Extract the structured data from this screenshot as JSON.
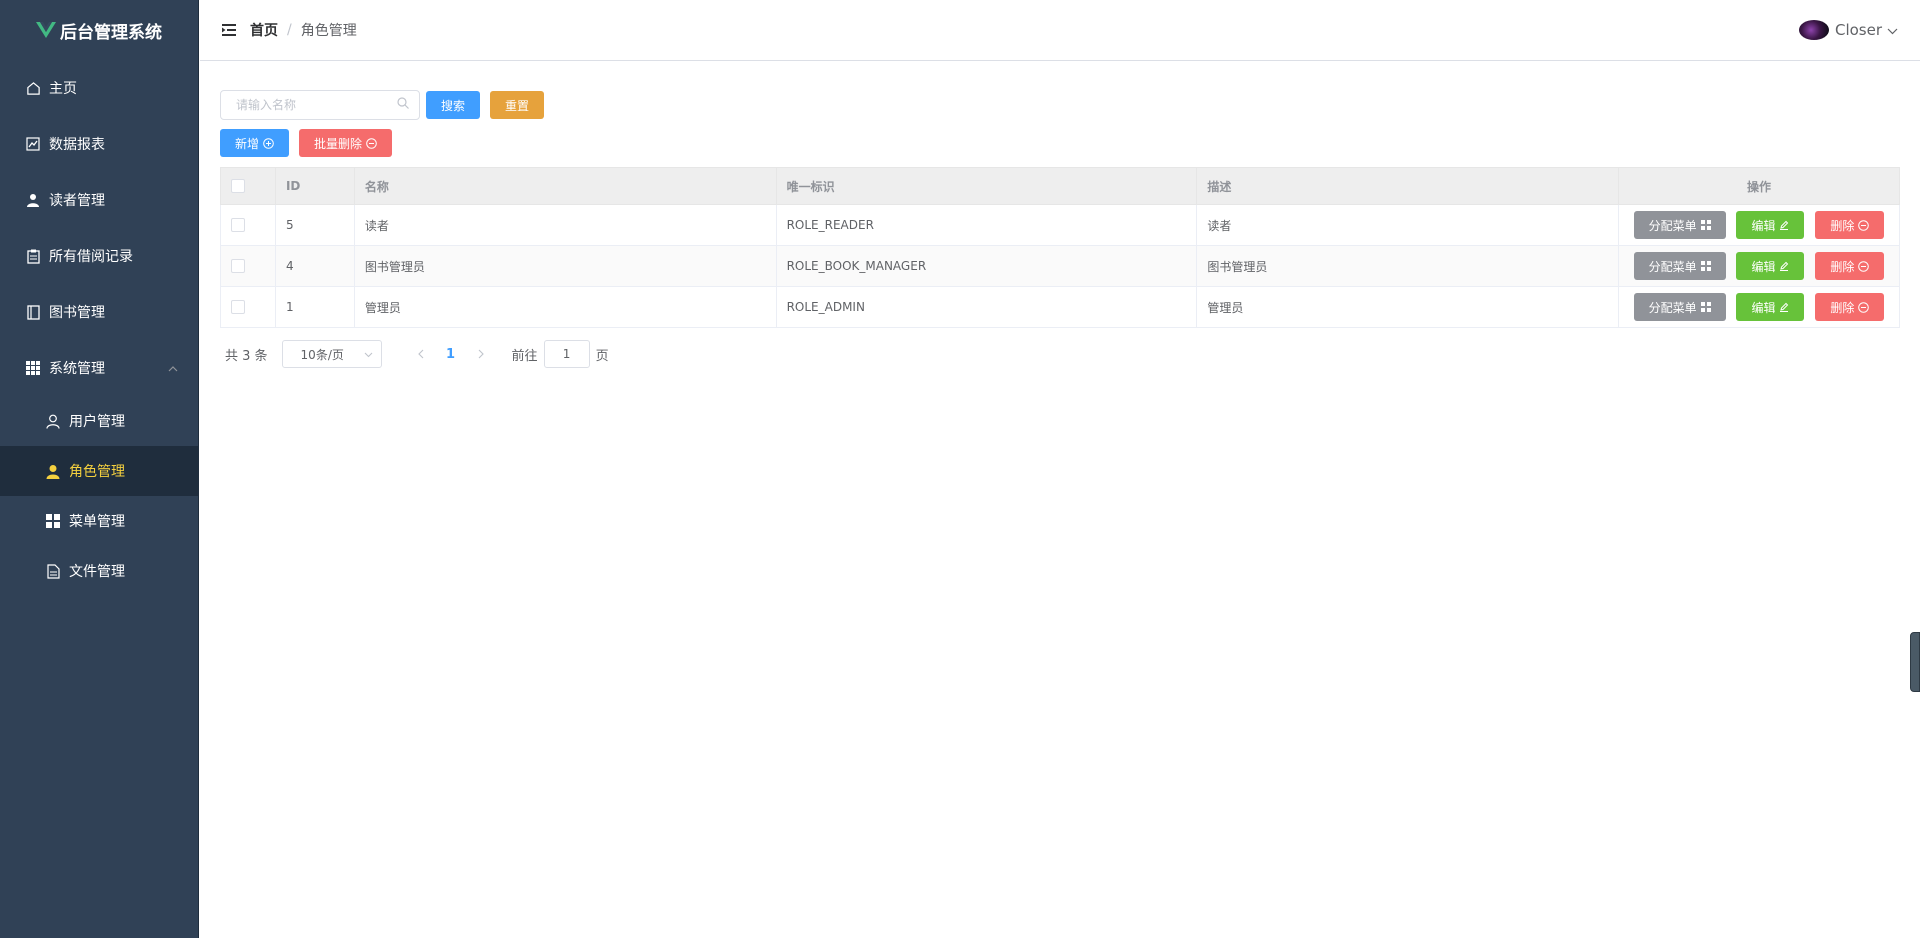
{
  "app": {
    "title": "后台管理系统",
    "logo_color": "#42b983"
  },
  "sidebar": {
    "items": [
      {
        "label": "主页",
        "icon": "home-icon"
      },
      {
        "label": "数据报表",
        "icon": "chart-icon"
      },
      {
        "label": "读者管理",
        "icon": "user-icon"
      },
      {
        "label": "所有借阅记录",
        "icon": "clipboard-icon"
      },
      {
        "label": "图书管理",
        "icon": "notebook-icon"
      },
      {
        "label": "系统管理",
        "icon": "grid-icon"
      }
    ],
    "submenu": [
      {
        "label": "用户管理",
        "icon": "user-outline-icon"
      },
      {
        "label": "角色管理",
        "icon": "user-solid-icon",
        "active": true
      },
      {
        "label": "菜单管理",
        "icon": "menu-grid-icon"
      },
      {
        "label": "文件管理",
        "icon": "document-icon"
      }
    ],
    "active_color": "#f4d03f"
  },
  "header": {
    "breadcrumb_home": "首页",
    "breadcrumb_sep": "/",
    "breadcrumb_current": "角色管理",
    "username": "Closer"
  },
  "toolbar": {
    "search_placeholder": "请输入名称",
    "search_label": "搜索",
    "reset_label": "重置",
    "add_label": "新增",
    "batch_delete_label": "批量删除"
  },
  "table": {
    "columns": [
      "ID",
      "名称",
      "唯一标识",
      "描述",
      "操作"
    ],
    "rows": [
      {
        "id": "5",
        "name": "读者",
        "flag": "ROLE_READER",
        "desc": "读者"
      },
      {
        "id": "4",
        "name": "图书管理员",
        "flag": "ROLE_BOOK_MANAGER",
        "desc": "图书管理员"
      },
      {
        "id": "1",
        "name": "管理员",
        "flag": "ROLE_ADMIN",
        "desc": "管理员"
      }
    ],
    "actions": {
      "assign": "分配菜单",
      "edit": "编辑",
      "delete": "删除"
    }
  },
  "pagination": {
    "total_text": "共 3 条",
    "page_size": "10条/页",
    "current_page": "1",
    "goto_prefix": "前往",
    "goto_value": "1",
    "goto_suffix": "页"
  }
}
